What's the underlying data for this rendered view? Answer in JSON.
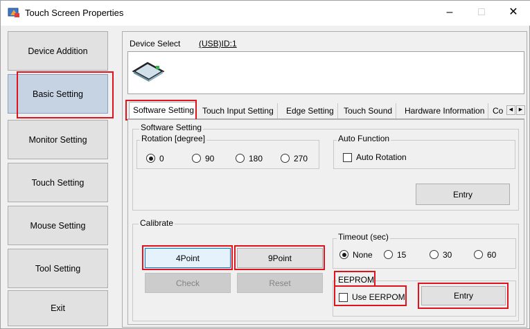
{
  "window": {
    "title": "Touch Screen Properties",
    "minimize": "–",
    "maximize": "□",
    "close": "✕",
    "icon": "touch-screen-app-icon"
  },
  "sidebar": {
    "items": [
      {
        "label": "Device Addition"
      },
      {
        "label": "Basic Setting"
      },
      {
        "label": "Monitor Setting"
      },
      {
        "label": "Touch Setting"
      },
      {
        "label": "Mouse Setting"
      },
      {
        "label": "Tool Setting"
      },
      {
        "label": "Exit"
      }
    ]
  },
  "device": {
    "select_label": "Device Select",
    "select_value": "(USB)ID:1"
  },
  "tabs": {
    "items": [
      {
        "label": "Software Setting"
      },
      {
        "label": "Touch Input Setting"
      },
      {
        "label": "Edge Setting"
      },
      {
        "label": "Touch Sound"
      },
      {
        "label": "Hardware Information"
      },
      {
        "label": "Co"
      }
    ],
    "scroll_left": "◀",
    "scroll_right": "▶"
  },
  "software": {
    "group_label": "Software Setting",
    "rotation": {
      "label": "Rotation [degree]",
      "options": [
        "0",
        "90",
        "180",
        "270"
      ],
      "selected": "0"
    },
    "auto_function": {
      "label": "Auto Function",
      "auto_rotation": "Auto Rotation"
    },
    "entry": "Entry"
  },
  "calibrate": {
    "label": "Calibrate",
    "point4": "4Point",
    "point9": "9Point",
    "check": "Check",
    "reset": "Reset",
    "timeout": {
      "label": "Timeout (sec)",
      "options": [
        "None",
        "15",
        "30",
        "60"
      ],
      "selected": "None"
    },
    "eeprom": {
      "label": "EEPROM",
      "use": "Use EERPOM",
      "entry": "Entry"
    }
  },
  "colors": {
    "highlight": "#e0121b",
    "active_nav": "#c5d3e3"
  }
}
